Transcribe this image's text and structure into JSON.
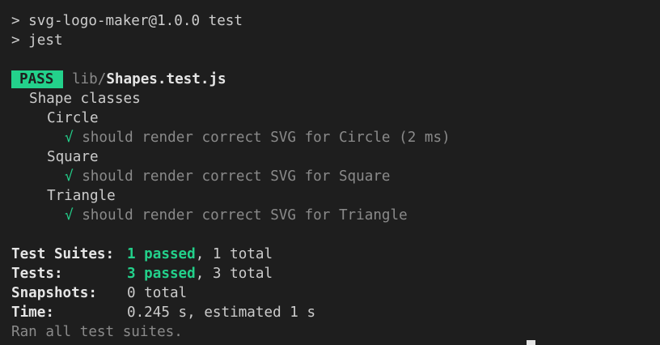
{
  "terminal": {
    "script_line": "> svg-logo-maker@1.0.0 test",
    "command_line": "> jest",
    "pass_badge": "PASS",
    "test_file_dir": "lib/",
    "test_file_name": "Shapes.test.js",
    "describe_root": "Shape classes",
    "groups": [
      {
        "name": "Circle",
        "check": "√",
        "test": "should render correct SVG for Circle (2 ms)"
      },
      {
        "name": "Square",
        "check": "√",
        "test": "should render correct SVG for Square"
      },
      {
        "name": "Triangle",
        "check": "√",
        "test": "should render correct SVG for Triangle"
      }
    ],
    "summary": {
      "suites_label": "Test Suites:",
      "suites_passed": "1 passed",
      "suites_rest": ", 1 total",
      "tests_label": "Tests:",
      "tests_passed": "3 passed",
      "tests_rest": ", 3 total",
      "snapshots_label": "Snapshots:",
      "snapshots_value": "0 total",
      "time_label": "Time:",
      "time_value": "0.245 s, estimated 1 s"
    },
    "footer": "Ran all test suites.",
    "colors": {
      "background": "#1e1e1e",
      "pass_green": "#23d18b",
      "text": "#cccccc",
      "dim": "#8a8a8a"
    }
  }
}
